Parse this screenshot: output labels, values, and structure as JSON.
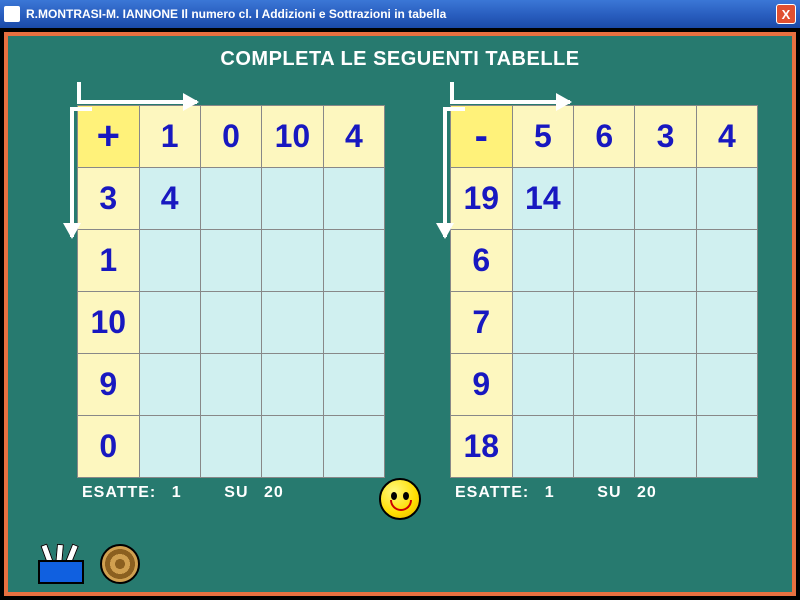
{
  "window": {
    "title": "R.MONTRASI-M. IANNONE   Il numero cl. I   Addizioni e Sottrazioni in tabella",
    "close": "X"
  },
  "heading": "COMPLETA LE SEGUENTI TABELLE",
  "tableA": {
    "op": "+",
    "cols": [
      "1",
      "0",
      "10",
      "4"
    ],
    "rows": [
      "3",
      "1",
      "10",
      "9",
      "0"
    ],
    "cells": [
      [
        "4",
        "",
        "",
        ""
      ],
      [
        "",
        "",
        "",
        ""
      ],
      [
        "",
        "",
        "",
        ""
      ],
      [
        "",
        "",
        "",
        ""
      ],
      [
        "",
        "",
        "",
        ""
      ]
    ]
  },
  "tableB": {
    "op": "-",
    "cols": [
      "5",
      "6",
      "3",
      "4"
    ],
    "rows": [
      "19",
      "6",
      "7",
      "9",
      "18"
    ],
    "cells": [
      [
        "14",
        "",
        "",
        ""
      ],
      [
        "",
        "",
        "",
        ""
      ],
      [
        "",
        "",
        "",
        ""
      ],
      [
        "",
        "",
        "",
        ""
      ],
      [
        "",
        "",
        "",
        ""
      ]
    ]
  },
  "status": {
    "label_correct": "ESATTE:",
    "label_of": "SU",
    "a_correct": "1",
    "a_total": "20",
    "b_correct": "1",
    "b_total": "20"
  }
}
